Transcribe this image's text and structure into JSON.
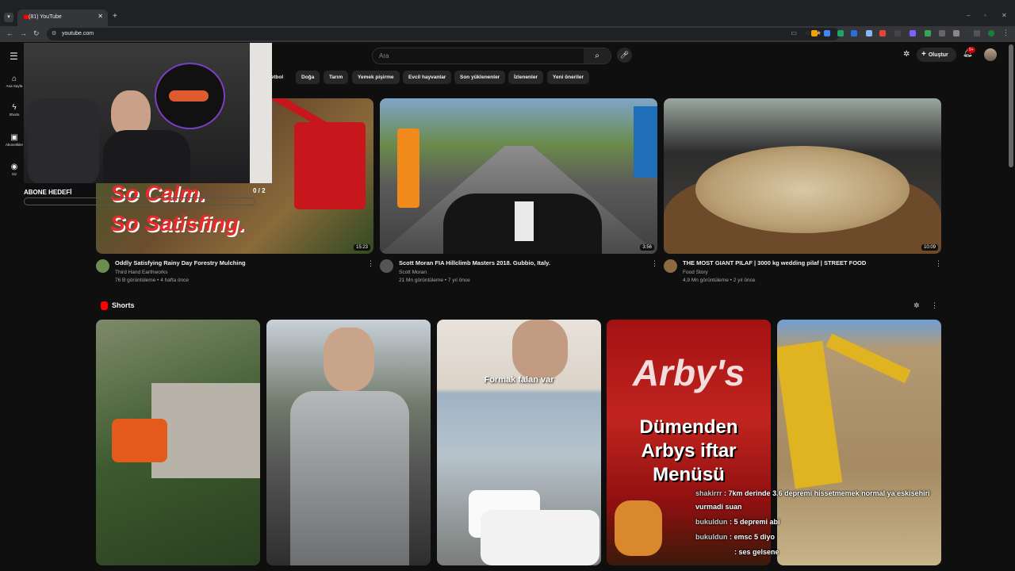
{
  "browser": {
    "tab_title": "(81) YouTube",
    "url": "youtube.com",
    "new_tab": "+",
    "close": "✕"
  },
  "youtube": {
    "sidebar": [
      {
        "label": "Ana Sayfa",
        "icon": "home-icon"
      },
      {
        "label": "Shorts",
        "icon": "shorts-icon"
      },
      {
        "label": "Abonelikler",
        "icon": "subscriptions-icon"
      },
      {
        "label": "Siz",
        "icon": "you-icon"
      }
    ],
    "search_placeholder": "Ara",
    "create_label": "Oluştur",
    "notification_count": "9+",
    "chips": [
      "ketbol",
      "Doğa",
      "Tarım",
      "Yemek pişirme",
      "Evcil hayvanlar",
      "Son yüklenenler",
      "İzlenenler",
      "Yeni öneriler"
    ],
    "videos": [
      {
        "title": "Oddly Satisfying Rainy Day Forestry Mulching",
        "channel": "Third Hand Earthworks",
        "meta": "76 B görüntüleme • 4 hafta önce",
        "duration": "15:23",
        "overlay1": "So Calm.",
        "overlay2": "So Satisfing."
      },
      {
        "title": "Scott Moran FIA Hillclimb Masters 2018. Gubbio, Italy.",
        "channel": "Scott Moran",
        "meta": "21 Mn görüntüleme • 7 yıl önce",
        "duration": "3:56"
      },
      {
        "title": "THE MOST GIANT PILAF | 3000 kg wedding pilaf | STREET FOOD",
        "channel": "Food Story",
        "meta": "4,9 Mn görüntüleme • 2 yıl önce",
        "duration": "10:09"
      }
    ],
    "shorts_label": "Shorts",
    "shorts": [
      {
        "caption": ""
      },
      {
        "caption": ""
      },
      {
        "caption": "Formak falan var"
      },
      {
        "caption1": "Dümenden",
        "caption2": "Arbys iftar",
        "caption3": "Menüsü"
      },
      {
        "caption": ""
      }
    ]
  },
  "stream_overlay": {
    "goal_label": "ABONE HEDEFİ",
    "goal_count": "0 / 2",
    "chat": [
      {
        "user": "shakirrr",
        "text": ": 7km derinde 3.6 depremi hissetmemek normal ya eskisehiri"
      },
      {
        "user": "",
        "text": "vurmadi suan"
      },
      {
        "user": "bukuldun",
        "text": ": 5 depremi abi"
      },
      {
        "user": "bukuldun",
        "text": ": emsc 5 diyo"
      },
      {
        "user": "",
        "text": ": ses gelsene"
      }
    ]
  }
}
